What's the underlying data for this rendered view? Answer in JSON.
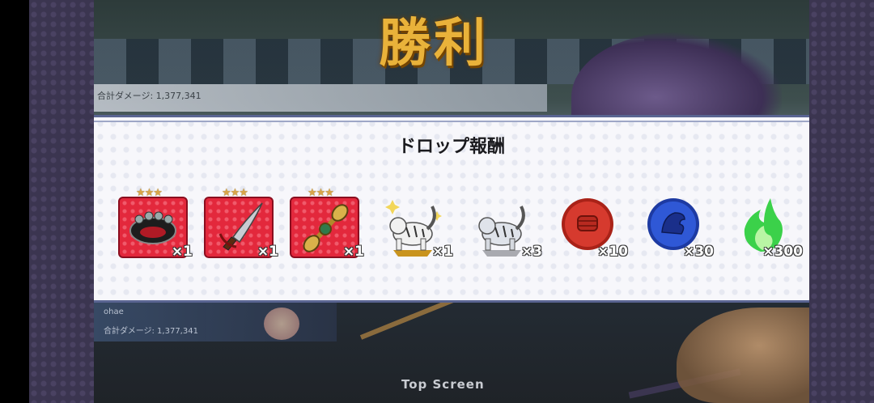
{
  "scene": {
    "victory_text": "勝利",
    "top_damage_text": "合計ダメージ: 1,377,341",
    "member_name": "ohae",
    "member_damage": "合計ダメージ: 1,377,341",
    "bottom_button": "Top Screen"
  },
  "reward_panel": {
    "title": "ドロップ報酬",
    "items": [
      {
        "icon": "brass-knuckles-icon",
        "stars": "★★★",
        "count": "×1",
        "rarity_color": "#e3283c"
      },
      {
        "icon": "curved-sword-icon",
        "stars": "★★★",
        "count": "×1",
        "rarity_color": "#e3283c"
      },
      {
        "icon": "vajra-icon",
        "stars": "★★★",
        "count": "×1",
        "rarity_color": "#e3283c"
      },
      {
        "icon": "gold-white-tiger-icon",
        "count": "×1"
      },
      {
        "icon": "silver-white-tiger-icon",
        "count": "×3"
      },
      {
        "icon": "red-fist-coin-icon",
        "count": "×10",
        "color": "#d63a2e"
      },
      {
        "icon": "blue-dragon-coin-icon",
        "count": "×30",
        "color": "#2f58d6"
      },
      {
        "icon": "green-flame-icon",
        "count": "×300",
        "color": "#3bd14a"
      }
    ]
  }
}
